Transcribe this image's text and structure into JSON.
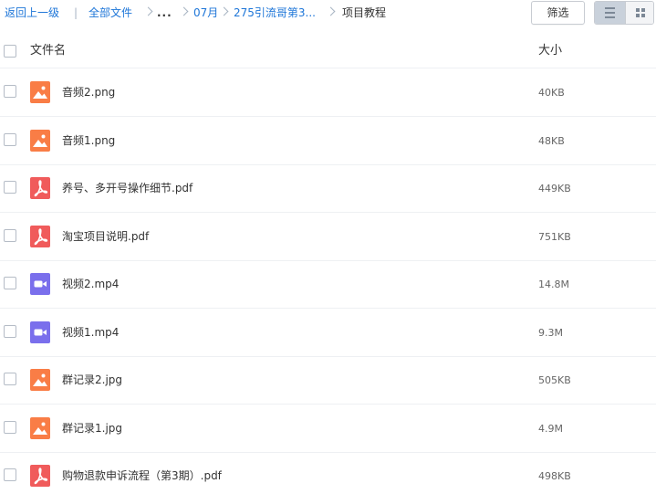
{
  "breadcrumb": {
    "back": "返回上一级",
    "separator": "|",
    "all_files": "全部文件",
    "ellipsis": "...",
    "crumb_month": "07月",
    "crumb_folder": "275引流哥第3...",
    "current": "项目教程"
  },
  "toolbar": {
    "filter_label": "筛选",
    "list_view_icon": "list-icon",
    "grid_view_icon": "grid-icon"
  },
  "table": {
    "header_name": "文件名",
    "header_size": "大小"
  },
  "colors": {
    "image": "#f97d46",
    "pdf": "#f05b5b",
    "video": "#7a6fec",
    "link": "#1e76d8"
  },
  "files": [
    {
      "name": "音频2.png",
      "size": "40KB",
      "type": "image"
    },
    {
      "name": "音频1.png",
      "size": "48KB",
      "type": "image"
    },
    {
      "name": "养号、多开号操作细节.pdf",
      "size": "449KB",
      "type": "pdf"
    },
    {
      "name": "淘宝项目说明.pdf",
      "size": "751KB",
      "type": "pdf"
    },
    {
      "name": "视频2.mp4",
      "size": "14.8M",
      "type": "video"
    },
    {
      "name": "视频1.mp4",
      "size": "9.3M",
      "type": "video"
    },
    {
      "name": "群记录2.jpg",
      "size": "505KB",
      "type": "image"
    },
    {
      "name": "群记录1.jpg",
      "size": "4.9M",
      "type": "image"
    },
    {
      "name": "购物退款申诉流程（第3期）.pdf",
      "size": "498KB",
      "type": "pdf"
    }
  ]
}
